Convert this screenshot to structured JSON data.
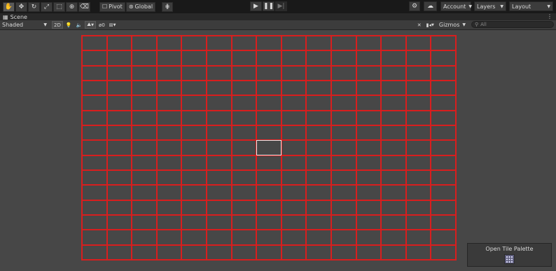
{
  "toolbar": {
    "tools": [
      {
        "name": "hand-tool",
        "glyph": "✋",
        "active": true
      },
      {
        "name": "move-tool",
        "glyph": "✥"
      },
      {
        "name": "rotate-tool",
        "glyph": "↻"
      },
      {
        "name": "scale-tool",
        "glyph": "⤢"
      },
      {
        "name": "rect-tool",
        "glyph": "⬚"
      },
      {
        "name": "transform-tool",
        "glyph": "⊕"
      },
      {
        "name": "custom-tool",
        "glyph": "⌫"
      }
    ],
    "pivot_label": "Pivot",
    "global_label": "Global",
    "play": "▶",
    "pause": "❚❚",
    "step": "▶|",
    "account_label": "Account",
    "layers_label": "Layers",
    "layout_label": "Layout"
  },
  "tab": {
    "title": "Scene"
  },
  "scenebar": {
    "shading": "Shaded",
    "mode_2d": "2D",
    "fx_count": "0",
    "gizmos_label": "Gizmos",
    "search_placeholder": "All"
  },
  "grid": {
    "rows": 15,
    "cols": 15,
    "highlight_row": 7,
    "highlight_col": 7,
    "line_color": "#d81e1e",
    "highlight_color": "#e8e8e8"
  },
  "overlay": {
    "title": "Open Tile Palette"
  }
}
